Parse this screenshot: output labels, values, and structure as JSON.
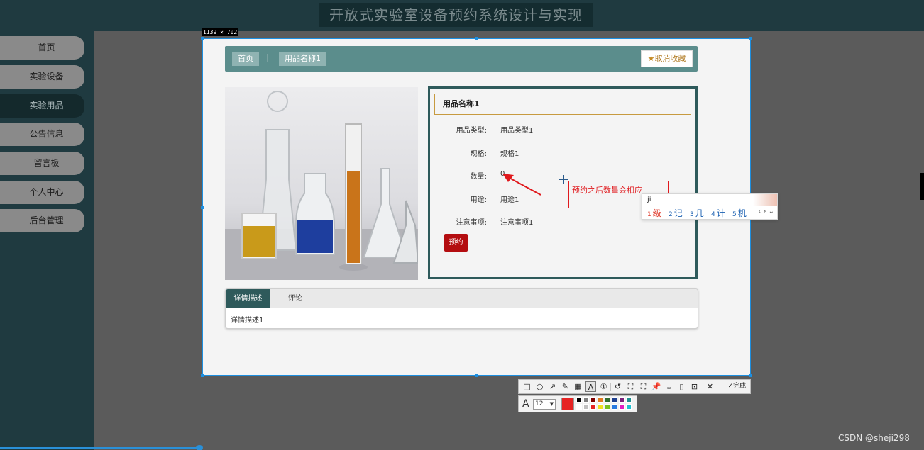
{
  "header": {
    "title": "开放式实验室设备预约系统设计与实现"
  },
  "sidebar": {
    "items": [
      {
        "label": "首页"
      },
      {
        "label": "实验设备"
      },
      {
        "label": "实验用品"
      },
      {
        "label": "公告信息"
      },
      {
        "label": "留言板"
      },
      {
        "label": "个人中心"
      },
      {
        "label": "后台管理"
      }
    ],
    "active_index": 2
  },
  "capture": {
    "size_label": "1139 × 702"
  },
  "breadcrumb": {
    "home": "首页",
    "current": "用品名称1"
  },
  "favorite_button": {
    "label": "取消收藏"
  },
  "product": {
    "title": "用品名称1",
    "fields": [
      {
        "label": "用品类型:",
        "value": "用品类型1"
      },
      {
        "label": "规格:",
        "value": "规格1"
      },
      {
        "label": "数量:",
        "value": "0"
      },
      {
        "label": "用途:",
        "value": "用途1"
      },
      {
        "label": "注意事项:",
        "value": "注意事项1"
      }
    ],
    "reserve_label": "预约"
  },
  "annotation": {
    "text": "预约之后数量会相应"
  },
  "tabs": [
    {
      "label": "详情描述",
      "active": true
    },
    {
      "label": "评论",
      "active": false
    }
  ],
  "tab_content": "详情描述1",
  "ime": {
    "input": "ji",
    "candidates": [
      {
        "num": "1",
        "text": "级"
      },
      {
        "num": "2",
        "text": "记"
      },
      {
        "num": "3",
        "text": "几"
      },
      {
        "num": "4",
        "text": "计"
      },
      {
        "num": "5",
        "text": "机"
      }
    ]
  },
  "toolbar": {
    "done_label": "完成",
    "font_size": "12",
    "current_color": "#e62424",
    "palette": [
      "#000000",
      "#808080",
      "#800000",
      "#e07b20",
      "#2f6b2f",
      "#1f3f8f",
      "#7a1f7a",
      "#1f8f8f",
      "#ffffff",
      "#c0c0c0",
      "#e62424",
      "#f0e020",
      "#7ac020",
      "#2a7ae0",
      "#e020c0",
      "#20c0d0"
    ]
  },
  "watermark": "CSDN @sheji298",
  "colors": {
    "accent": "#2e5a5b",
    "danger": "#b40d10",
    "annotation": "#e0191d",
    "frame": "#1d8fe0"
  }
}
